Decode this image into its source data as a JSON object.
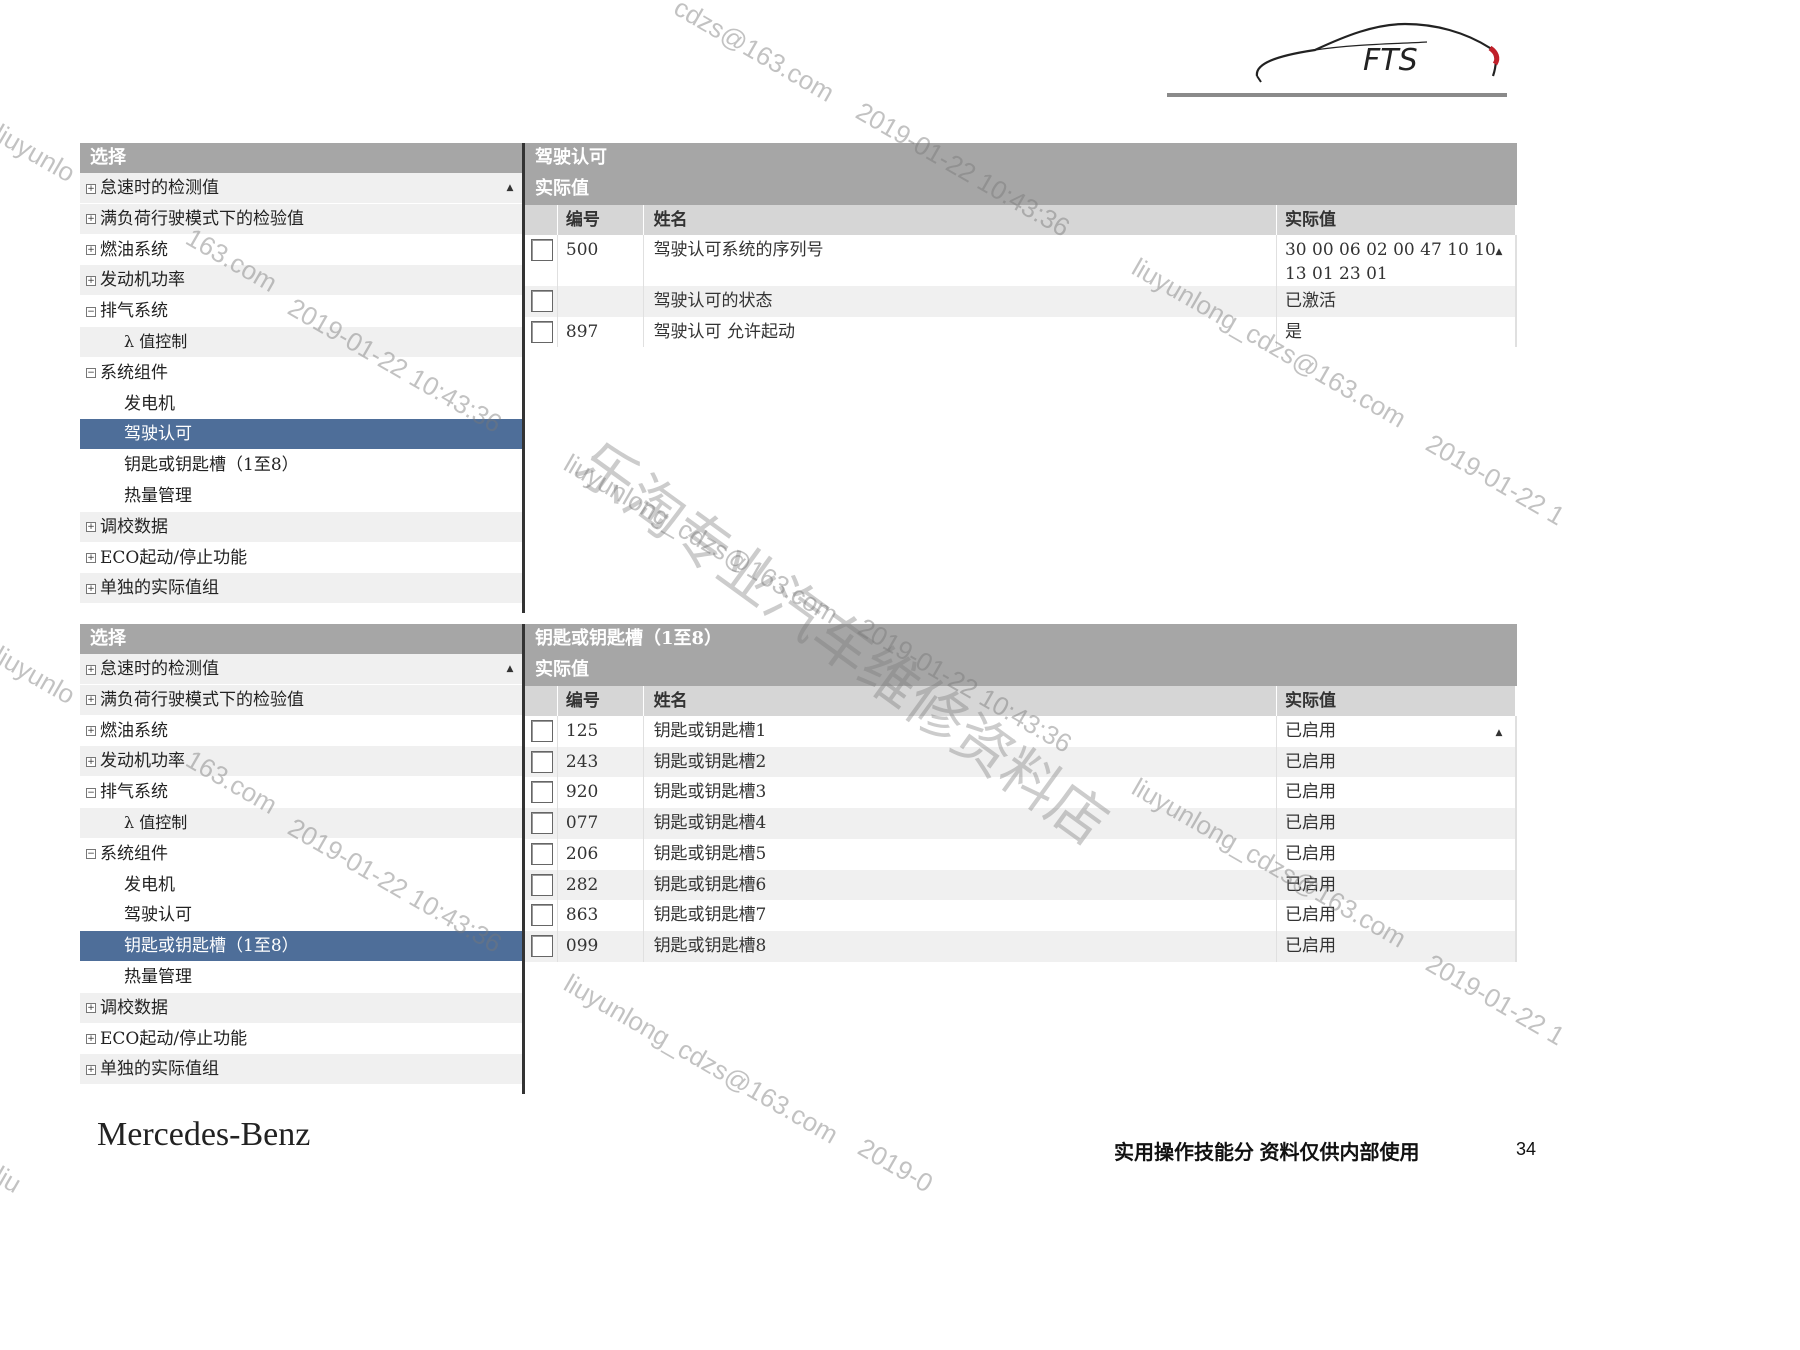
{
  "logo_text": "FTS",
  "brand": "Mercedes-Benz",
  "footer_text": "实用操作技能分 资料仅供内部使用",
  "page_number": "34",
  "watermark": {
    "email": "liuyunlong_cdzs@163.com",
    "email_a": "liuyunlong_cdzs@163.com",
    "email_b": "cdzs@163.com",
    "email_c": "liuyunlo",
    "email_d": "163.com",
    "email_e": "liuyunlong_cdzs@163.com",
    "email_f": "liuyunlong_cdzs@163.com",
    "email_g": "163.com",
    "email_h": "liuyunlo",
    "email_i": "liuyunlong_cdzs@163.com",
    "email_j": "liu",
    "date": "2019-01-22 10:43:36",
    "date_a": "2019-01-22 10:43:36",
    "date_b": "2019-01-22 10:43:36",
    "date_c": "2019-01-22 1",
    "date_d": "2019-01-22 10:43:36",
    "date_e": "2019-01-22 1",
    "date_f": "2019-01-22 10:43:36",
    "date_g": "2019-0",
    "store": "乐淘专业汽车维修资料店"
  },
  "top": {
    "tree_header": "选择",
    "tree": [
      {
        "expander": "+",
        "label": "怠速时的检测值"
      },
      {
        "expander": "+",
        "label": "满负荷行驶模式下的检验值"
      },
      {
        "expander": "+",
        "label": "燃油系统"
      },
      {
        "expander": "+",
        "label": "发动机功率"
      },
      {
        "expander": "−",
        "label": "排气系统"
      },
      {
        "expander": "",
        "label": "λ 值控制"
      },
      {
        "expander": "−",
        "label": "系统组件"
      },
      {
        "expander": "",
        "label": "发电机"
      },
      {
        "expander": "",
        "label": "驾驶认可"
      },
      {
        "expander": "",
        "label": "钥匙或钥匙槽（1至8）"
      },
      {
        "expander": "",
        "label": "热量管理"
      },
      {
        "expander": "+",
        "label": "调校数据"
      },
      {
        "expander": "+",
        "label": "ECO起动/停止功能"
      },
      {
        "expander": "+",
        "label": "单独的实际值组"
      }
    ],
    "grid_title": "驾驶认可",
    "grid_subtitle": "实际值",
    "columns": {
      "num": "编号",
      "name": "姓名",
      "value": "实际值"
    },
    "rows": [
      {
        "num": "500",
        "name": "驾驶认可系统的序列号",
        "value": "30 00 06 02 00 47 10 10 13 01 23 01"
      },
      {
        "num": "",
        "name": "驾驶认可的状态",
        "value": "已激活"
      },
      {
        "num": "897",
        "name": "驾驶认可 允许起动",
        "value": "是"
      }
    ]
  },
  "bottom": {
    "tree_header": "选择",
    "tree": [
      {
        "expander": "+",
        "label": "怠速时的检测值"
      },
      {
        "expander": "+",
        "label": "满负荷行驶模式下的检验值"
      },
      {
        "expander": "+",
        "label": "燃油系统"
      },
      {
        "expander": "+",
        "label": "发动机功率"
      },
      {
        "expander": "−",
        "label": "排气系统"
      },
      {
        "expander": "",
        "label": "λ 值控制"
      },
      {
        "expander": "−",
        "label": "系统组件"
      },
      {
        "expander": "",
        "label": "发电机"
      },
      {
        "expander": "",
        "label": "驾驶认可"
      },
      {
        "expander": "",
        "label": "钥匙或钥匙槽（1至8）"
      },
      {
        "expander": "",
        "label": "热量管理"
      },
      {
        "expander": "+",
        "label": "调校数据"
      },
      {
        "expander": "+",
        "label": "ECO起动/停止功能"
      },
      {
        "expander": "+",
        "label": "单独的实际值组"
      }
    ],
    "grid_title": "钥匙或钥匙槽（1至8）",
    "grid_subtitle": "实际值",
    "columns": {
      "num": "编号",
      "name": "姓名",
      "value": "实际值"
    },
    "rows": [
      {
        "num": "125",
        "name": "钥匙或钥匙槽1",
        "value": "已启用"
      },
      {
        "num": "243",
        "name": "钥匙或钥匙槽2",
        "value": "已启用"
      },
      {
        "num": "920",
        "name": "钥匙或钥匙槽3",
        "value": "已启用"
      },
      {
        "num": "077",
        "name": "钥匙或钥匙槽4",
        "value": "已启用"
      },
      {
        "num": "206",
        "name": "钥匙或钥匙槽5",
        "value": "已启用"
      },
      {
        "num": "282",
        "name": "钥匙或钥匙槽6",
        "value": "已启用"
      },
      {
        "num": "863",
        "name": "钥匙或钥匙槽7",
        "value": "已启用"
      },
      {
        "num": "099",
        "name": "钥匙或钥匙槽8",
        "value": "已启用"
      }
    ]
  }
}
